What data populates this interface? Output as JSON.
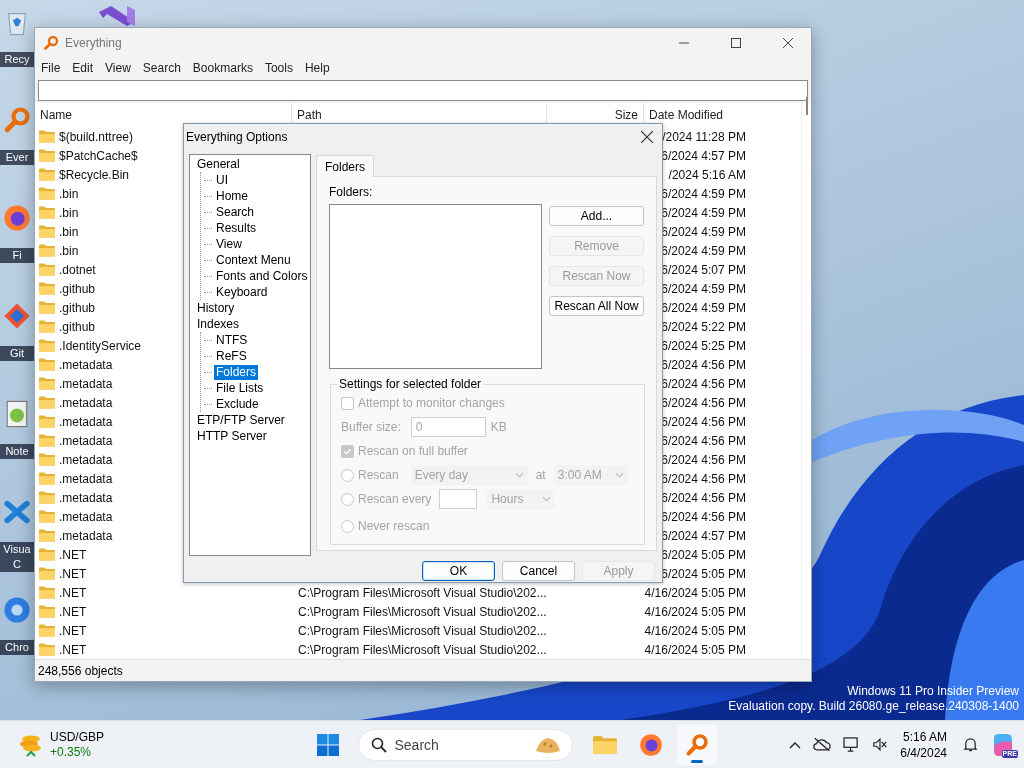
{
  "desktop": {
    "icons": [
      {
        "kind": "recycle-bin",
        "label": "Recy"
      },
      {
        "kind": "magnifier",
        "label": "Ever"
      },
      {
        "kind": "orb",
        "label": "Fi"
      },
      {
        "kind": "diamond",
        "label": "Git"
      },
      {
        "kind": "notepad",
        "label": "Note"
      },
      {
        "kind": "cross",
        "label": "Visua C"
      },
      {
        "kind": "circle",
        "label": "Chro"
      }
    ]
  },
  "os_notice": {
    "lines": [
      "Windows 11 Pro Insider Preview",
      "Evaluation copy. Build 26080.ge_release.240308-1400"
    ]
  },
  "main_window": {
    "title": "Everything",
    "menu": [
      "File",
      "Edit",
      "View",
      "Search",
      "Bookmarks",
      "Tools",
      "Help"
    ],
    "columns": [
      "Name",
      "Path",
      "Size",
      "Date Modified"
    ],
    "rows": [
      {
        "name": "$(build.nttree)",
        "date": "/2024 11:28 PM"
      },
      {
        "name": "$PatchCache$",
        "date": "6/2024 4:57 PM"
      },
      {
        "name": "$Recycle.Bin",
        "date": "/2024 5:16 AM"
      },
      {
        "name": ".bin",
        "date": "6/2024 4:59 PM"
      },
      {
        "name": ".bin",
        "date": "6/2024 4:59 PM"
      },
      {
        "name": ".bin",
        "date": "6/2024 4:59 PM"
      },
      {
        "name": ".bin",
        "date": "6/2024 4:59 PM"
      },
      {
        "name": ".dotnet",
        "date": "6/2024 5:07 PM"
      },
      {
        "name": ".github",
        "date": "6/2024 4:59 PM"
      },
      {
        "name": ".github",
        "date": "6/2024 4:59 PM"
      },
      {
        "name": ".github",
        "date": "6/2024 5:22 PM"
      },
      {
        "name": ".IdentityService",
        "date": "6/2024 5:25 PM"
      },
      {
        "name": ".metadata",
        "date": "6/2024 4:56 PM"
      },
      {
        "name": ".metadata",
        "date": "6/2024 4:56 PM"
      },
      {
        "name": ".metadata",
        "date": "6/2024 4:56 PM"
      },
      {
        "name": ".metadata",
        "date": "6/2024 4:56 PM"
      },
      {
        "name": ".metadata",
        "date": "6/2024 4:56 PM"
      },
      {
        "name": ".metadata",
        "date": "6/2024 4:56 PM"
      },
      {
        "name": ".metadata",
        "date": "6/2024 4:56 PM"
      },
      {
        "name": ".metadata",
        "date": "6/2024 4:56 PM"
      },
      {
        "name": ".metadata",
        "date": "6/2024 4:56 PM"
      },
      {
        "name": ".metadata",
        "date": "6/2024 4:57 PM"
      },
      {
        "name": ".NET",
        "date": "6/2024 5:05 PM"
      },
      {
        "name": ".NET",
        "date": "6/2024 5:05 PM"
      },
      {
        "name": ".NET",
        "path": "C:\\Program Files\\Microsoft Visual Studio\\202...",
        "date": "4/16/2024 5:05 PM"
      },
      {
        "name": ".NET",
        "path": "C:\\Program Files\\Microsoft Visual Studio\\202...",
        "date": "4/16/2024 5:05 PM"
      },
      {
        "name": ".NET",
        "path": "C:\\Program Files\\Microsoft Visual Studio\\202...",
        "date": "4/16/2024 5:05 PM"
      },
      {
        "name": ".NET",
        "path": "C:\\Program Files\\Microsoft Visual Studio\\202...",
        "date": "4/16/2024 5:05 PM"
      }
    ],
    "status": "248,556 objects"
  },
  "options_dialog": {
    "title": "Everything Options",
    "tree": [
      {
        "label": "General",
        "selected": false,
        "children": [
          {
            "label": "UI",
            "selected": false
          },
          {
            "label": "Home",
            "selected": false
          },
          {
            "label": "Search",
            "selected": false
          },
          {
            "label": "Results",
            "selected": false
          },
          {
            "label": "View",
            "selected": false
          },
          {
            "label": "Context Menu",
            "selected": false
          },
          {
            "label": "Fonts and Colors",
            "selected": false
          },
          {
            "label": "Keyboard",
            "selected": false
          }
        ]
      },
      {
        "label": "History",
        "selected": false
      },
      {
        "label": "Indexes",
        "selected": false,
        "children": [
          {
            "label": "NTFS",
            "selected": false
          },
          {
            "label": "ReFS",
            "selected": false
          },
          {
            "label": "Folders",
            "selected": true
          },
          {
            "label": "File Lists",
            "selected": false
          },
          {
            "label": "Exclude",
            "selected": false
          }
        ]
      },
      {
        "label": "ETP/FTP Server",
        "selected": false
      },
      {
        "label": "HTTP Server",
        "selected": false
      }
    ],
    "tabs": [
      {
        "label": "Folders",
        "selected": true
      }
    ],
    "folders_label": "Folders:",
    "folder_buttons": [
      {
        "label": "Add...",
        "disabled": false
      },
      {
        "label": "Remove",
        "disabled": true
      },
      {
        "label": "Rescan Now",
        "disabled": true
      },
      {
        "label": "Rescan All Now",
        "disabled": false
      }
    ],
    "settings": {
      "title": "Settings for selected folder",
      "disabled": true,
      "monitor": {
        "label": "Attempt to monitor changes",
        "checked": false
      },
      "buffer": {
        "label": "Buffer size:",
        "value": "0",
        "unit": "KB"
      },
      "full_buffer": {
        "label": "Rescan on full buffer",
        "checked": true
      },
      "rescan_daily": {
        "label": "Rescan",
        "selected": false,
        "frequency": "Every day",
        "at_label": "at",
        "time": "3:00 AM"
      },
      "rescan_every": {
        "label": "Rescan every",
        "selected": false,
        "unit": "Hours"
      },
      "never": {
        "label": "Never rescan",
        "selected": false
      }
    },
    "buttons": [
      {
        "label": "OK",
        "default": true,
        "disabled": false
      },
      {
        "label": "Cancel",
        "default": false,
        "disabled": false
      },
      {
        "label": "Apply",
        "default": false,
        "disabled": true
      }
    ]
  },
  "taskbar": {
    "widget": {
      "symbol": "USD/GBP",
      "change": "+0.35%"
    },
    "search": {
      "placeholder": "Search"
    },
    "apps": [
      {
        "kind": "folder",
        "selected": false
      },
      {
        "kind": "orb",
        "selected": false
      },
      {
        "kind": "magnifier",
        "selected": true
      }
    ],
    "clock": {
      "time": "5:16 AM",
      "date": "6/4/2024"
    },
    "badge": "PRE"
  }
}
